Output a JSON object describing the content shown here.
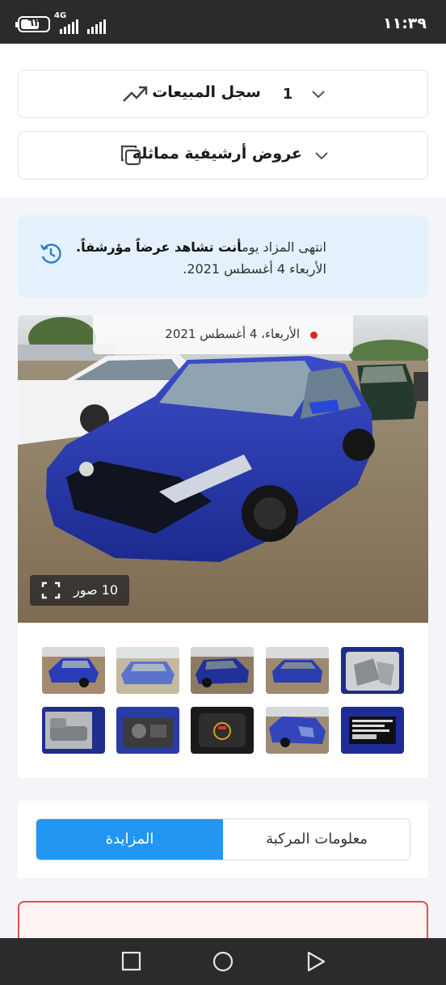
{
  "status_bar": {
    "time": "١١:٣٩",
    "battery": "٦٢",
    "network": "4G"
  },
  "sales_history": {
    "title": "سجل المبيعات",
    "count": "1",
    "icon": "trending-up-icon"
  },
  "similar_offers": {
    "title": "عروض أرشيفية مماثلة",
    "icon": "copy-icon"
  },
  "notice": {
    "text_before": "انتهى المزاد يوم",
    "text_bold": "أنت تشاهد عرضاً مؤرشفاً.",
    "date_line": "الأربعاء 4 أغسطس 2021."
  },
  "gallery": {
    "date_banner": "الأربعاء، 4 أغسطس 2021",
    "photo_count_label": "10 صور",
    "car_color": "#2838b0",
    "thumbnails": [
      "front-left-view",
      "front-view",
      "rear-left-view",
      "rear-view",
      "interior-front-seats",
      "interior-rear-seats",
      "engine-bay",
      "dashboard-cluster",
      "rear-right-damage",
      "vin-label"
    ]
  },
  "tabs": {
    "vehicle_info": "معلومات المركبة",
    "auction": "المزايدة",
    "active": "auction",
    "active_color": "#2196f3"
  }
}
